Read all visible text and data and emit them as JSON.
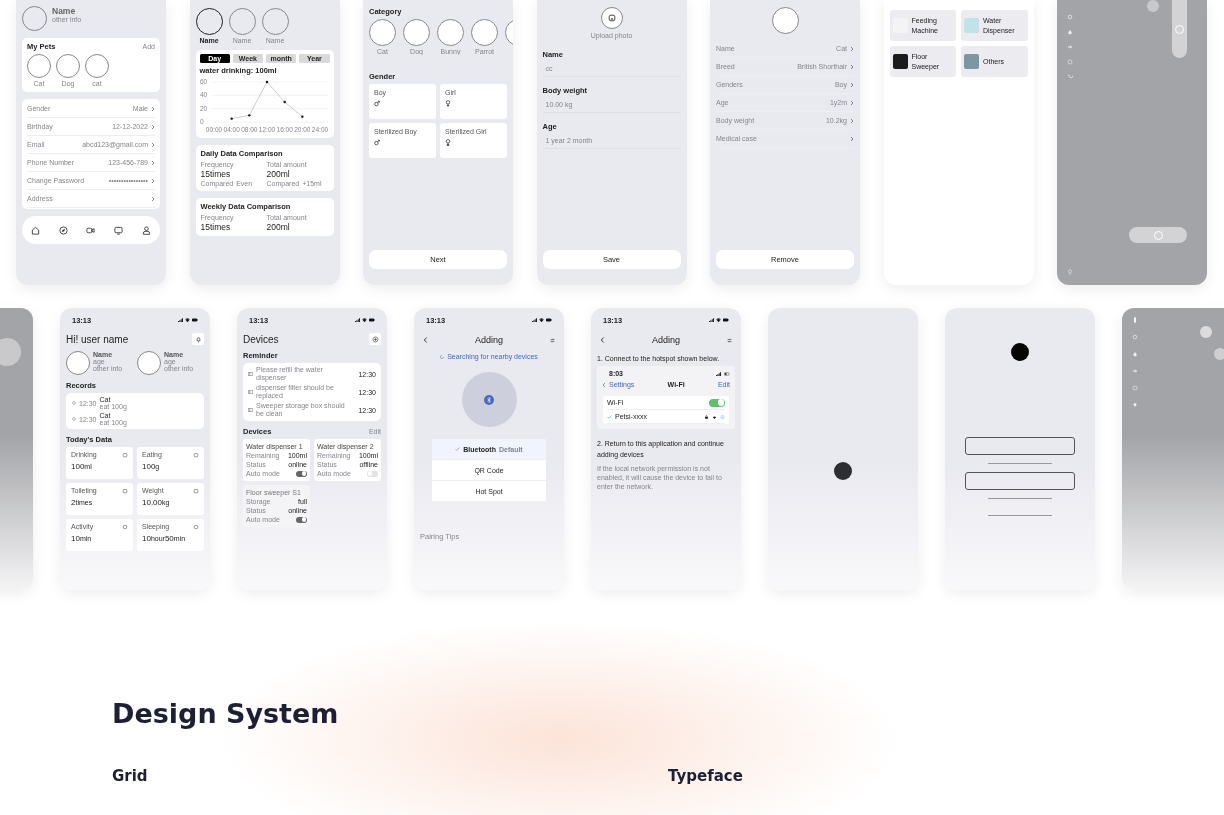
{
  "row1": [
    {
      "kind": "profile",
      "user": {
        "name": "Name",
        "info": "other info"
      },
      "pets_title": "My Pets",
      "pets_action": "Add",
      "pets": [
        "Cat",
        "Dog",
        "cat"
      ],
      "fields": [
        {
          "label": "Gender",
          "value": "Male"
        },
        {
          "label": "Birthday",
          "value": "12-12-2022"
        },
        {
          "label": "Email",
          "value": "abcd123@gmail.com"
        },
        {
          "label": "Phone Number",
          "value": "123-456-789"
        },
        {
          "label": "Change Password",
          "value": "••••••••••••••••"
        },
        {
          "label": "Address"
        }
      ]
    },
    {
      "kind": "stats",
      "pets": [
        {
          "name": "Name",
          "selected": true
        },
        {
          "name": "Name",
          "selected": false
        },
        {
          "name": "Name",
          "selected": false
        }
      ],
      "periods": [
        {
          "label": "Day",
          "selected": true
        },
        {
          "label": "Week",
          "selected": false
        },
        {
          "label": "month",
          "selected": false
        },
        {
          "label": "Year",
          "selected": false
        }
      ],
      "chart_title": "water drinking: 100ml",
      "chart_data": {
        "type": "line",
        "categories": [
          "00:00",
          "04:00",
          "08:00",
          "12:00",
          "16:00",
          "20:00",
          "24:00"
        ],
        "series": [
          {
            "values": [
              null,
              5,
              10,
              60,
              30,
              8,
              null
            ]
          }
        ],
        "ylim": [
          0,
          60
        ],
        "yticks": [
          0,
          20,
          40,
          60
        ]
      },
      "comparisons": [
        {
          "title": "Daily Data Comparison",
          "stats": [
            {
              "label": "Frequency",
              "value": "15times",
              "compare_label": "Compared",
              "compare": "Even"
            },
            {
              "label": "Total amount",
              "value": "200ml",
              "compare_label": "Compared",
              "compare": "+15ml"
            }
          ]
        },
        {
          "title": "Weekly Data Comparison",
          "stats": [
            {
              "label": "Frequency",
              "value": "15times"
            },
            {
              "label": "Total amount",
              "value": "200ml"
            }
          ]
        }
      ]
    },
    {
      "kind": "category",
      "category_title": "Category",
      "categories": [
        "Cat",
        "Dog",
        "Bunny",
        "Parrot"
      ],
      "gender_title": "Gender",
      "genders": [
        "Boy",
        "Girl",
        "Sterilized Boy",
        "Sterilized Girl"
      ],
      "button": "Next"
    },
    {
      "kind": "form",
      "upload": "Upload photo",
      "fields": [
        {
          "label": "Name",
          "value": "cc"
        },
        {
          "label": "Body weight",
          "value": "10.00 kg"
        },
        {
          "label": "Age",
          "value": "1 year 2 month"
        }
      ],
      "button": "Save"
    },
    {
      "kind": "detail",
      "rows": [
        {
          "label": "Name",
          "value": "Cat"
        },
        {
          "label": "Breed",
          "value": "British Shorthair"
        },
        {
          "label": "Genders",
          "value": "Boy"
        },
        {
          "label": "Age",
          "value": "1y2m"
        },
        {
          "label": "Body weight",
          "value": "10.2kg"
        },
        {
          "label": "Medical case"
        }
      ],
      "button": "Remove"
    },
    {
      "kind": "device-types",
      "items": [
        "Feeding Machine",
        "Water Dispenser",
        "Floor Sweeper",
        "Others"
      ]
    },
    {
      "kind": "control"
    }
  ],
  "row2": [
    {
      "kind": "control-partial"
    },
    {
      "kind": "home",
      "time": "13:13",
      "title": "Hi! user name",
      "pets": [
        {
          "name": "Name",
          "age": "age",
          "info": "other info"
        },
        {
          "name": "Name",
          "age": "age",
          "info": "other info"
        }
      ],
      "records_title": "Records",
      "records": [
        {
          "time": "12:30",
          "name": "Cat",
          "detail": "eat 100g"
        },
        {
          "time": "12:30",
          "name": "Cat",
          "detail": "eat 100g"
        }
      ],
      "today_title": "Today's Data",
      "tiles": [
        {
          "label": "Drinking",
          "parts": [
            {
              "value": "100",
              "unit": "ml"
            }
          ]
        },
        {
          "label": "Eating",
          "parts": [
            {
              "value": "100",
              "unit": "g"
            }
          ]
        },
        {
          "label": "Toileting",
          "parts": [
            {
              "value": "2",
              "unit": "times"
            }
          ]
        },
        {
          "label": "Weight",
          "parts": [
            {
              "value": "10.00",
              "unit": "kg"
            }
          ]
        },
        {
          "label": "Activity",
          "parts": [
            {
              "value": "10",
              "unit": "min"
            }
          ]
        },
        {
          "label": "Sleeping",
          "parts": [
            {
              "value": "10",
              "unit": "hour"
            },
            {
              "value": "50",
              "unit": "min"
            }
          ]
        }
      ]
    },
    {
      "kind": "device-list",
      "time": "13:13",
      "title": "Devices",
      "reminder_title": "Reminder",
      "reminders": [
        {
          "text": "Please refill the water dispenser",
          "time": "12:30"
        },
        {
          "text": "dispenser filter should be replaced",
          "time": "12:30"
        },
        {
          "text": "Sweeper storage box should be clean",
          "time": "12:30"
        }
      ],
      "devices_title": "Devices",
      "devices_action": "Edit",
      "devices": [
        {
          "name": "Water dispenser 1",
          "rows": [
            {
              "label": "Remaining",
              "value": "100ml"
            },
            {
              "label": "Status",
              "value": "online"
            }
          ],
          "auto_label": "Auto mode",
          "on": true,
          "disabled": false
        },
        {
          "name": "Water dispenser 2",
          "rows": [
            {
              "label": "Remaining",
              "value": "100ml"
            },
            {
              "label": "Status",
              "value": "offline"
            }
          ],
          "auto_label": "Auto mode",
          "on": false,
          "disabled": false
        },
        {
          "name": "Floor sweeper S1",
          "rows": [
            {
              "label": "Storage",
              "value": "full"
            },
            {
              "label": "Status",
              "value": "online"
            }
          ],
          "auto_label": "Auto mode",
          "on": true,
          "disabled": true
        }
      ]
    },
    {
      "kind": "adding-bluetooth",
      "time": "13:13",
      "title": "Adding",
      "status": "Searching for nearby devices",
      "options": [
        {
          "label": "Bluetooth",
          "note": "Default",
          "selected": true
        },
        {
          "label": "QR Code",
          "selected": false
        },
        {
          "label": "Hot Spot",
          "selected": false
        }
      ],
      "tips_title": "Pairing Tips"
    },
    {
      "kind": "adding-hotspot",
      "time": "13:13",
      "title": "Adding",
      "step1": "1. Connect to the hotspot shown below.",
      "inner": {
        "time": "8:03",
        "back": "Settings",
        "title": "Wi-Fi",
        "action": "Edit",
        "wifi_label": "Wi-Fi",
        "wifi_on": true,
        "network": "Petsi-xxxx",
        "network_selected": true
      },
      "step2": "2. Return to this application and continue adding devices",
      "note": "If the local network permission is not enabled, it will cause the device to fail to enter the network."
    },
    {
      "kind": "blank"
    },
    {
      "kind": "wireframe"
    },
    {
      "kind": "control-side"
    }
  ],
  "design": {
    "title": "Design System",
    "grid": "Grid",
    "typeface": "Typeface"
  }
}
